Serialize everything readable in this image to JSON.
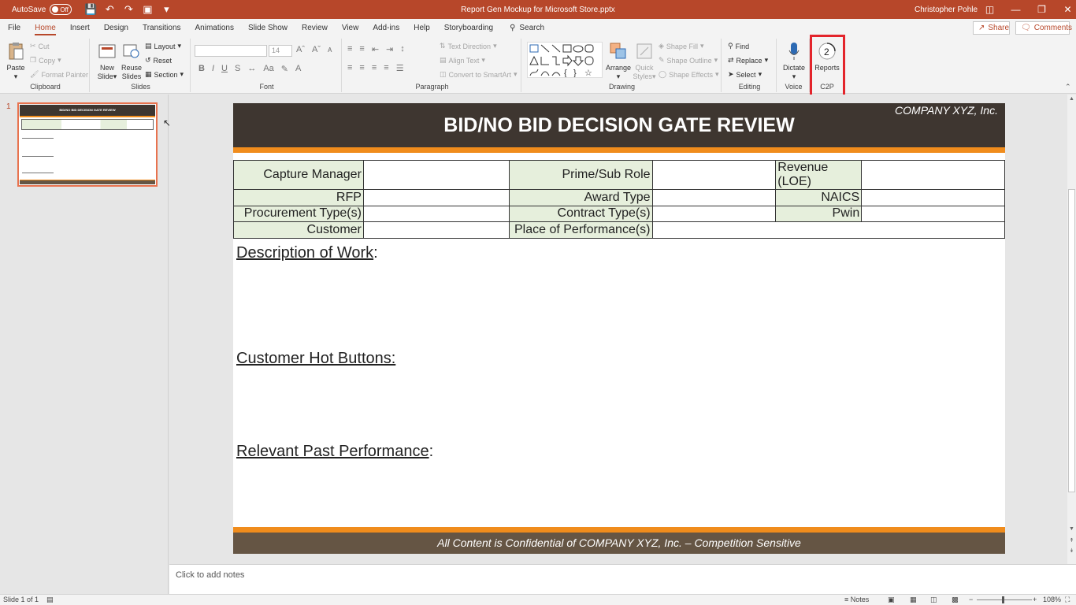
{
  "titlebar": {
    "autosave_label": "AutoSave",
    "autosave_state": "Off",
    "document_title": "Report Gen Mockup for Microsoft Store.pptx",
    "user_name": "Christopher Pohle"
  },
  "tabs": [
    "File",
    "Home",
    "Insert",
    "Design",
    "Transitions",
    "Animations",
    "Slide Show",
    "Review",
    "View",
    "Add-ins",
    "Help",
    "Storyboarding"
  ],
  "active_tab": "Home",
  "search_label": "Search",
  "share_label": "Share",
  "comments_label": "Comments",
  "ribbon": {
    "clipboard": {
      "label": "Clipboard",
      "paste": "Paste",
      "cut": "Cut",
      "copy": "Copy",
      "format_painter": "Format Painter"
    },
    "slides": {
      "label": "Slides",
      "new_slide_1": "New",
      "new_slide_2": "Slide",
      "reuse_1": "Reuse",
      "reuse_2": "Slides",
      "layout": "Layout",
      "reset": "Reset",
      "section": "Section"
    },
    "font": {
      "label": "Font",
      "size": "14"
    },
    "paragraph": {
      "label": "Paragraph",
      "text_direction": "Text Direction",
      "align_text": "Align Text",
      "convert_smartart": "Convert to SmartArt"
    },
    "drawing": {
      "label": "Drawing",
      "arrange": "Arrange",
      "quick_styles_1": "Quick",
      "quick_styles_2": "Styles",
      "shape_fill": "Shape Fill",
      "shape_outline": "Shape Outline",
      "shape_effects": "Shape Effects"
    },
    "editing": {
      "label": "Editing",
      "find": "Find",
      "replace": "Replace",
      "select": "Select"
    },
    "voice": {
      "label": "Voice",
      "dictate": "Dictate"
    },
    "c2p": {
      "label": "C2P",
      "reports": "Reports",
      "badge": "2"
    }
  },
  "slide_pane": {
    "number": "1"
  },
  "thumb": {
    "title": "BID/NO BID DECISION GATE REVIEW"
  },
  "slide": {
    "company": "COMPANY XYZ, Inc.",
    "title": "BID/NO BID DECISION GATE REVIEW",
    "grid_rows": [
      [
        "Capture Manager",
        "Prime/Sub Role",
        "Revenue (LOE)"
      ],
      [
        "RFP",
        "Award Type",
        "NAICS"
      ],
      [
        "Procurement Type(s)",
        "Contract Type(s)",
        "Pwin"
      ],
      [
        "Customer",
        "Place of Performance(s)"
      ]
    ],
    "sections": [
      "Description of Work",
      "Customer Hot Buttons:",
      "Relevant Past Performance"
    ],
    "footer": "All Content is Confidential of COMPANY XYZ, Inc. – Competition Sensitive"
  },
  "notes_placeholder": "Click to add notes",
  "status": {
    "slide_count": "Slide 1 of 1",
    "notes": "Notes",
    "zoom": "108%"
  },
  "colors": {
    "accent": "#b7472a",
    "slide_header": "#3e3630",
    "slide_orange": "#f08c1c",
    "slide_footer": "#655544",
    "label_fill": "#e6efdc",
    "highlight": "#e3242b"
  }
}
